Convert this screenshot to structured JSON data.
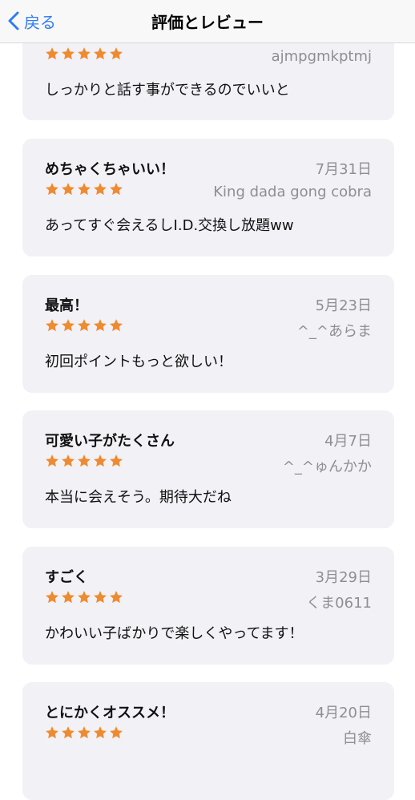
{
  "nav": {
    "back_label": "戻る",
    "title": "評価とレビュー"
  },
  "colors": {
    "accent": "#2f7cf6",
    "star": "#f18a2e",
    "card_bg": "#f1f1f6",
    "secondary_text": "#8e8e93"
  },
  "reviews": [
    {
      "title": "",
      "date": "",
      "author": "ajmpgmkptmj",
      "rating": 5,
      "body": "しっかりと話す事ができるのでいいと"
    },
    {
      "title": "めちゃくちゃいい！",
      "date": "7月31日",
      "author": "King dada gong cobra",
      "rating": 5,
      "body": "あってすぐ会えるしI.D.交換し放題ww"
    },
    {
      "title": "最高！",
      "date": "5月23日",
      "author": "^_^あらま",
      "rating": 5,
      "body": "初回ポイントもっと欲しい！"
    },
    {
      "title": "可愛い子がたくさん",
      "date": "4月7日",
      "author": "^_^ゅんかか",
      "rating": 5,
      "body": "本当に会えそう。期待大だね"
    },
    {
      "title": "すごく",
      "date": "3月29日",
      "author": "くま0611",
      "rating": 5,
      "body": "かわいい子ばかりで楽しくやってます！"
    },
    {
      "title": "とにかくオススメ！",
      "date": "4月20日",
      "author": "白傘",
      "rating": 5,
      "body": ""
    }
  ]
}
